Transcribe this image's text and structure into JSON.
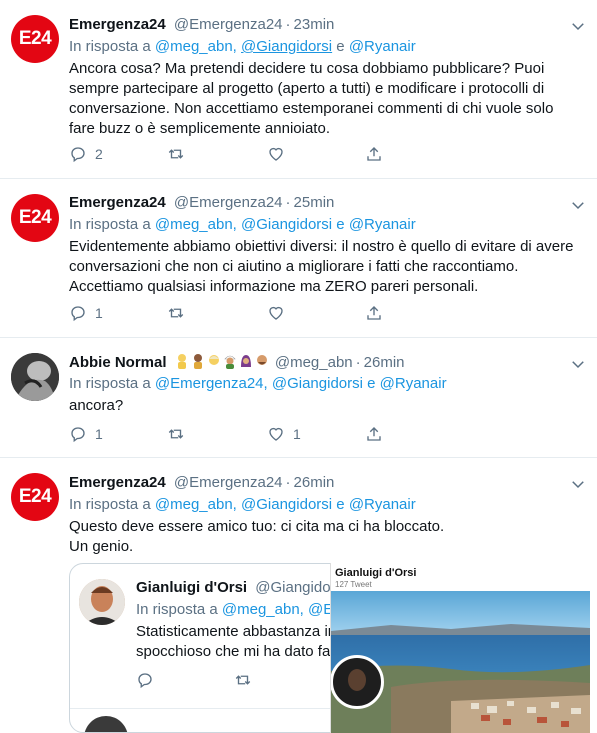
{
  "tweets": [
    {
      "avatar_text": "E24",
      "name": "Emergenza24",
      "handle": "@Emergenza24",
      "time": "23min",
      "reply_prefix": "In risposta a",
      "mention1": "@meg_abn,",
      "mention2": "@Giangidorsi",
      "and_word": "e",
      "mention3": "@Ryanair",
      "text": "Ancora cosa? Ma pretendi decidere tu cosa dobbiamo pubblicare? Puoi sempre partecipare al progetto (aperto a tutti) e modificare i protocolli di conversazione. Non accettiamo estemporanei commenti di chi vuole solo fare buzz o è semplicemente annioiato.",
      "reply_count": "2"
    },
    {
      "avatar_text": "E24",
      "name": "Emergenza24",
      "handle": "@Emergenza24",
      "time": "25min",
      "reply_prefix": "In risposta a",
      "mention1": "@meg_abn,",
      "mention2": "@Giangidorsi",
      "and_word": "e",
      "mention3": "@Ryanair",
      "text": "Evidentemente abbiamo obiettivi diversi: il nostro è quello di evitare di avere conversazioni che non ci aiutino a migliorare i fatti che raccontiamo. Accettiamo qualsiasi informazione ma ZERO pareri personali.",
      "reply_count": "1"
    },
    {
      "name": "Abbie Normal",
      "handle": "@meg_abn",
      "time": "26min",
      "reply_prefix": "In risposta a",
      "mention1": "@Emergenza24,",
      "mention2": "@Giangidorsi",
      "and_word": "e",
      "mention3": "@Ryanair",
      "text": "ancora?",
      "reply_count": "1",
      "like_count": "1"
    },
    {
      "avatar_text": "E24",
      "name": "Emergenza24",
      "handle": "@Emergenza24",
      "time": "26min",
      "reply_prefix": "In risposta a",
      "mention1": "@meg_abn,",
      "mention2": "@Giangidorsi",
      "and_word": "e",
      "mention3": "@Ryanair",
      "text_line1": "Questo deve essere amico tuo: ci cita ma ci ha bloccato.",
      "text_line2": "Un genio."
    }
  ],
  "quoted": {
    "name": "Gianluigi d'Orsi",
    "handle": "@Giangidor",
    "reply_prefix": "In risposta a",
    "mention1": "@meg_abn,",
    "mention2": "@E",
    "line1": "Statisticamente abbastanza ir",
    "line2": "spocchioso che mi ha dato fa"
  },
  "popup": {
    "name": "Gianluigi d'Orsi",
    "sub": "127 Tweet"
  },
  "colors": {
    "accent": "#1b95e0",
    "brand_red": "#e30613",
    "muted": "#5b7083"
  },
  "icons": [
    "reply-icon",
    "retweet-icon",
    "like-icon",
    "share-icon",
    "chevron-down-icon"
  ]
}
